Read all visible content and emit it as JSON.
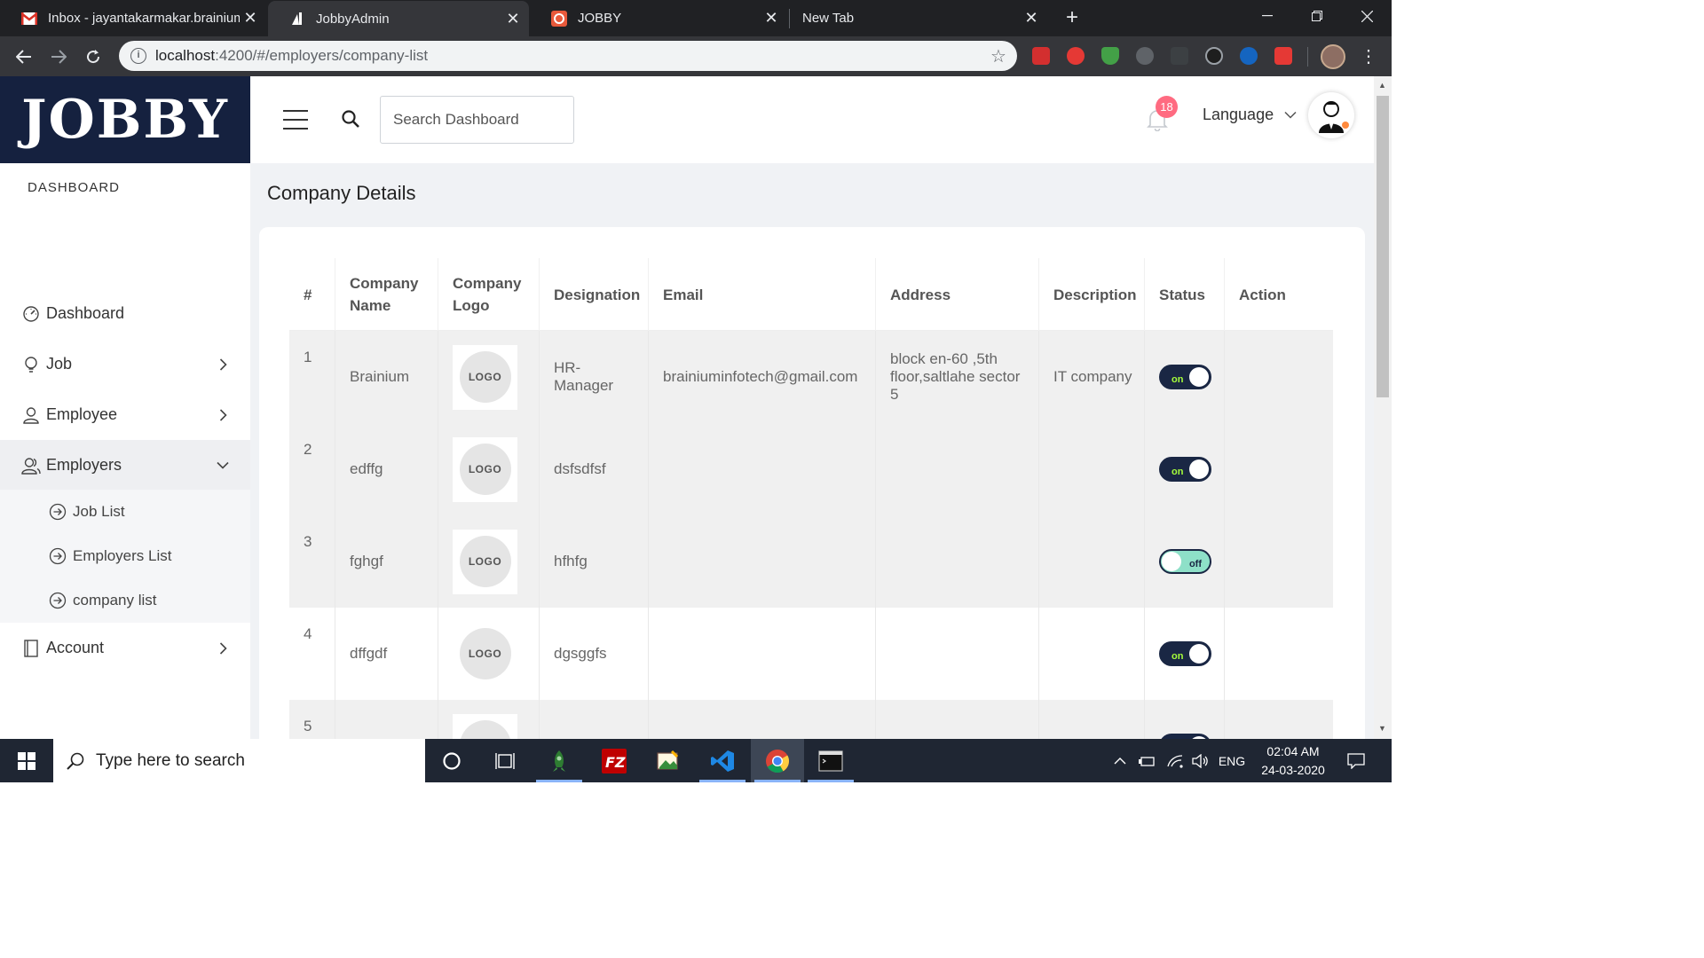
{
  "browser": {
    "tabs": [
      {
        "title": "Inbox - jayantakarmakar.brainium",
        "active": false
      },
      {
        "title": "JobbyAdmin",
        "active": true
      },
      {
        "title": "JOBBY",
        "active": false
      },
      {
        "title": "New Tab",
        "active": false
      }
    ],
    "url_host": "localhost",
    "url_rest": ":4200/#/employers/company-list"
  },
  "app": {
    "logo": "JOBBY",
    "search_placeholder": "Search Dashboard",
    "notification_count": "18",
    "language_label": "Language",
    "page_title": "Company Details"
  },
  "sidebar": {
    "heading": "DASHBOARD",
    "items": [
      {
        "label": "Dashboard",
        "icon": "gauge-icon"
      },
      {
        "label": "Job",
        "icon": "lightbulb-icon"
      },
      {
        "label": "Employee",
        "icon": "user-icon"
      },
      {
        "label": "Employers",
        "icon": "users-icon"
      },
      {
        "label": "Account",
        "icon": "book-icon"
      }
    ],
    "sub_items": [
      {
        "label": "Job List"
      },
      {
        "label": "Employers List"
      },
      {
        "label": "company list"
      }
    ]
  },
  "table": {
    "columns": [
      "#",
      "Company Name",
      "Company Logo",
      "Designation",
      "Email",
      "Address",
      "Description",
      "Status",
      "Action"
    ],
    "logo_text": "LOGO",
    "rows": [
      {
        "num": "1",
        "name": "Brainium",
        "designation": "HR-Manager",
        "email": "brainiuminfotech@gmail.com",
        "address": "block en-60 ,5th floor,saltlahe sector 5",
        "description": "IT company",
        "status": "on"
      },
      {
        "num": "2",
        "name": "edffg",
        "designation": "dsfsdfsf",
        "email": "",
        "address": "",
        "description": "",
        "status": "on"
      },
      {
        "num": "3",
        "name": "fghgf",
        "designation": "hfhfg",
        "email": "",
        "address": "",
        "description": "",
        "status": "off"
      },
      {
        "num": "4",
        "name": "dffgdf",
        "designation": "dgsggfs",
        "email": "",
        "address": "",
        "description": "",
        "status": "on"
      },
      {
        "num": "5",
        "name": "",
        "designation": "",
        "email": "",
        "address": "",
        "description": "",
        "status": "on"
      }
    ]
  },
  "taskbar": {
    "search_placeholder": "Type here to search",
    "language": "ENG",
    "time": "02:04 AM",
    "date": "24-03-2020"
  },
  "colors": {
    "sidebar_logo_bg": "#15213f",
    "toggle_on": "#1a2744",
    "toggle_off": "#8ee0c8",
    "badge": "#ff6b81"
  }
}
